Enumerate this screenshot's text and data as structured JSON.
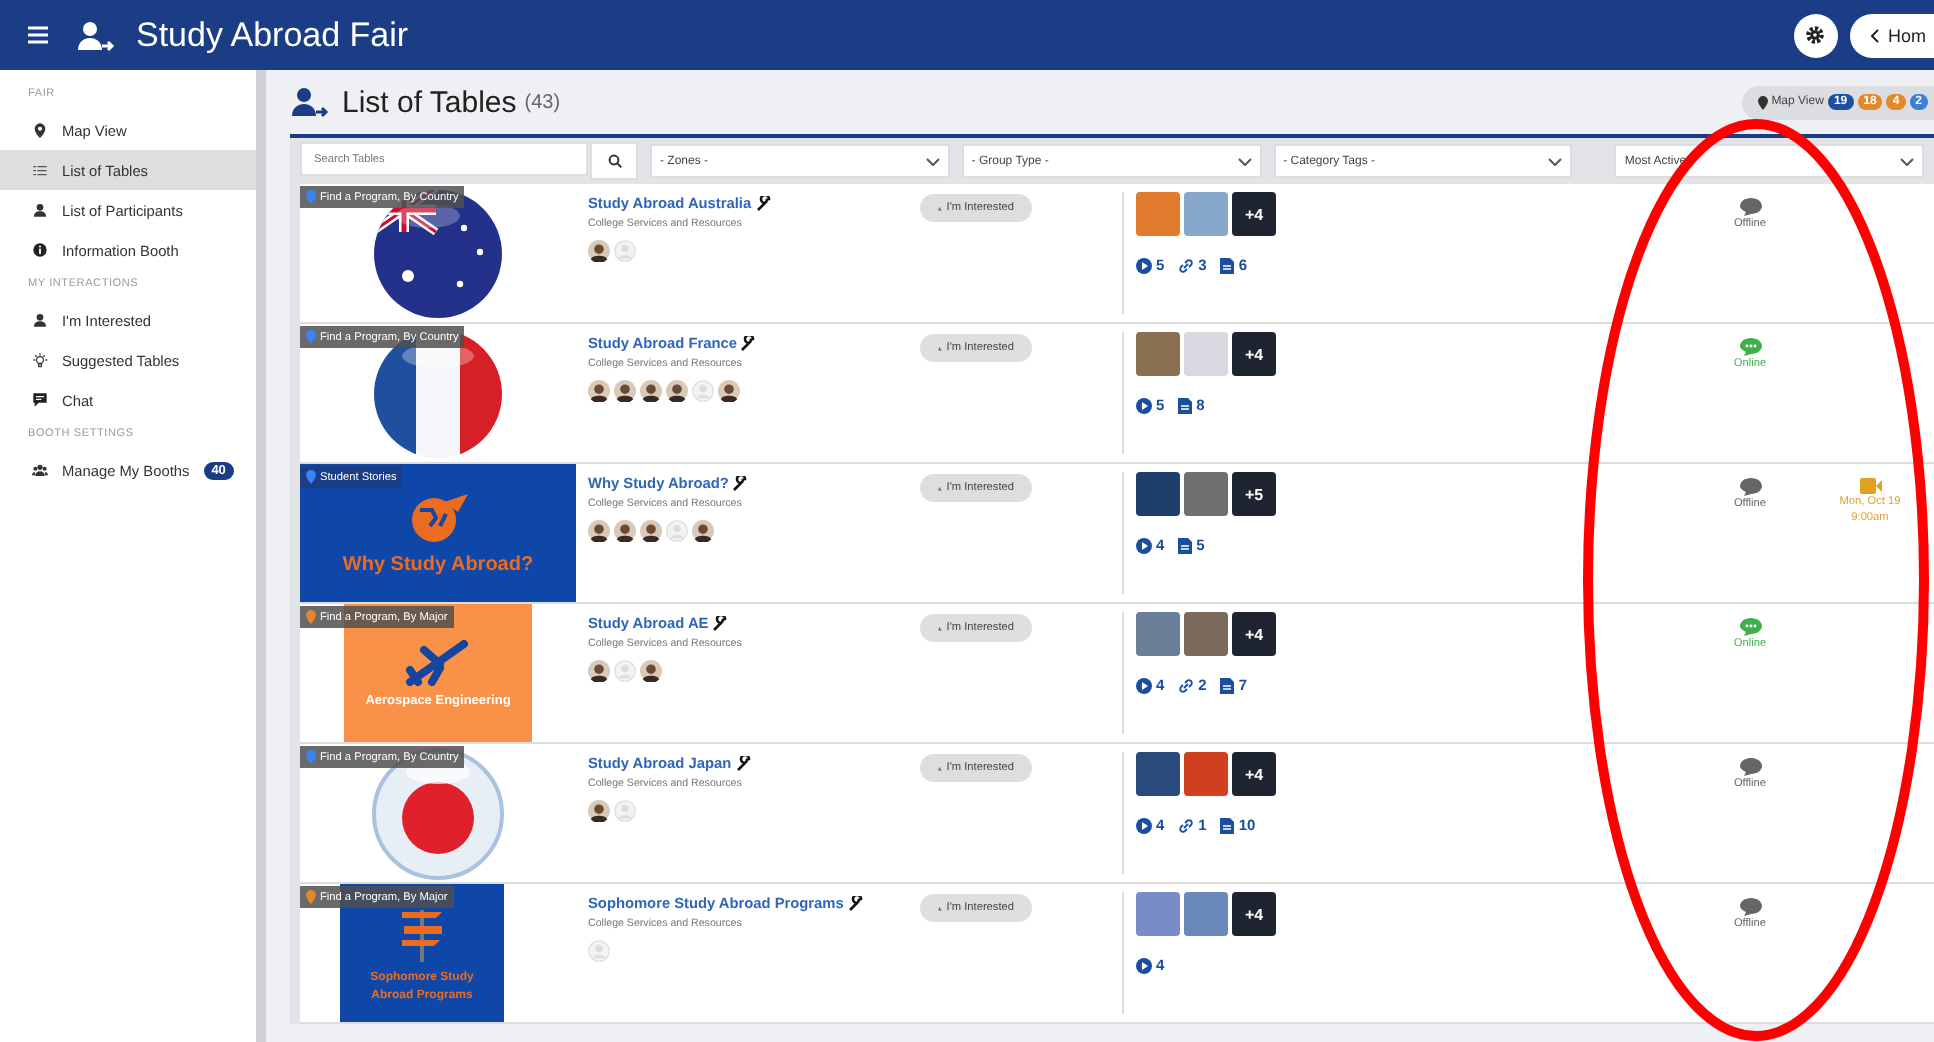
{
  "header": {
    "title": "Study Abroad Fair",
    "home_button": "Hom"
  },
  "sidebar": {
    "sections": [
      {
        "heading": "FAIR",
        "items": [
          {
            "label": "Map View",
            "selected": false
          },
          {
            "label": "List of Tables",
            "selected": true
          },
          {
            "label": "List of Participants",
            "selected": false
          },
          {
            "label": "Information Booth",
            "selected": false
          }
        ]
      },
      {
        "heading": "MY INTERACTIONS",
        "items": [
          {
            "label": "I'm Interested",
            "selected": false
          },
          {
            "label": "Suggested Tables",
            "selected": false
          },
          {
            "label": "Chat",
            "selected": false
          }
        ]
      },
      {
        "heading": "BOOTH SETTINGS",
        "items": [
          {
            "label": "Manage My Booths",
            "selected": false,
            "badge": "40"
          }
        ]
      }
    ]
  },
  "page": {
    "title": "List of Tables",
    "count": "(43)",
    "map_view": {
      "label": "Map View",
      "badges": [
        {
          "text": "19",
          "color": "#1e4ea1"
        },
        {
          "text": "18",
          "color": "#e08a2c"
        },
        {
          "text": "4",
          "color": "#e08a2c"
        },
        {
          "text": "2",
          "color": "#3b82d6"
        }
      ]
    }
  },
  "filters": {
    "search_placeholder": "Search Tables",
    "selects": [
      "- Zones -",
      "- Group Type -",
      "- Category Tags -",
      "Most Active"
    ]
  },
  "rows": [
    {
      "tag": {
        "text": "Find a Program, By Country",
        "kind": "country"
      },
      "image": {
        "kind": "flag-au"
      },
      "name": "Study Abroad Australia",
      "subtitle": "College Services and Resources",
      "avatars": [
        {
          "kind": "photo"
        },
        {
          "kind": "blank"
        }
      ],
      "button": "I'm Interested",
      "more": "+4",
      "stats": [
        {
          "kind": "video",
          "count": "5"
        },
        {
          "kind": "link",
          "count": "3"
        },
        {
          "kind": "doc",
          "count": "6"
        }
      ],
      "status": {
        "online": false,
        "label": "Offline"
      }
    },
    {
      "tag": {
        "text": "Find a Program, By Country",
        "kind": "country"
      },
      "image": {
        "kind": "flag-fr"
      },
      "name": "Study Abroad France",
      "subtitle": "College Services and Resources",
      "avatars": [
        {
          "kind": "photo"
        },
        {
          "kind": "photo"
        },
        {
          "kind": "photo"
        },
        {
          "kind": "photo"
        },
        {
          "kind": "blank"
        },
        {
          "kind": "photo"
        }
      ],
      "button": "I'm Interested",
      "more": "+4",
      "stats": [
        {
          "kind": "video",
          "count": "5"
        },
        {
          "kind": "doc",
          "count": "8"
        }
      ],
      "status": {
        "online": true,
        "label": "Online"
      }
    },
    {
      "tag": {
        "text": "Student Stories",
        "kind": "stories"
      },
      "image": {
        "kind": "globe-banner",
        "text": "Why Study Abroad?"
      },
      "name": "Why Study Abroad?",
      "subtitle": "College Services and Resources",
      "avatars": [
        {
          "kind": "photo"
        },
        {
          "kind": "photo"
        },
        {
          "kind": "photo"
        },
        {
          "kind": "blank"
        },
        {
          "kind": "photo"
        }
      ],
      "button": "I'm Interested",
      "more": "+5",
      "stats": [
        {
          "kind": "video",
          "count": "4"
        },
        {
          "kind": "doc",
          "count": "5"
        }
      ],
      "status": {
        "online": false,
        "label": "Offline"
      },
      "event": {
        "date": "Mon, Oct 19",
        "time": "9:00am"
      }
    },
    {
      "tag": {
        "text": "Find a Program, By Major",
        "kind": "major"
      },
      "image": {
        "kind": "plane-banner",
        "text": "Aerospace Engineering"
      },
      "name": "Study Abroad AE",
      "subtitle": "College Services and Resources",
      "avatars": [
        {
          "kind": "photo"
        },
        {
          "kind": "blank"
        },
        {
          "kind": "photo"
        }
      ],
      "button": "I'm Interested",
      "more": "+4",
      "stats": [
        {
          "kind": "video",
          "count": "4"
        },
        {
          "kind": "link",
          "count": "2"
        },
        {
          "kind": "doc",
          "count": "7"
        }
      ],
      "status": {
        "online": true,
        "label": "Online"
      }
    },
    {
      "tag": {
        "text": "Find a Program, By Country",
        "kind": "country"
      },
      "image": {
        "kind": "flag-jp"
      },
      "name": "Study Abroad Japan",
      "subtitle": "College Services and Resources",
      "avatars": [
        {
          "kind": "photo"
        },
        {
          "kind": "blank"
        }
      ],
      "button": "I'm Interested",
      "more": "+4",
      "stats": [
        {
          "kind": "video",
          "count": "4"
        },
        {
          "kind": "link",
          "count": "1"
        },
        {
          "kind": "doc",
          "count": "10"
        }
      ],
      "status": {
        "online": false,
        "label": "Offline"
      }
    },
    {
      "tag": {
        "text": "Find a Program, By Major",
        "kind": "major"
      },
      "image": {
        "kind": "sign-banner",
        "text": "Sophomore Study Abroad Programs"
      },
      "name": "Sophomore Study Abroad Programs",
      "subtitle": "College Services and Resources",
      "avatars": [
        {
          "kind": "blank"
        }
      ],
      "button": "I'm Interested",
      "more": "+4",
      "stats": [
        {
          "kind": "video",
          "count": "4"
        }
      ],
      "status": {
        "online": false,
        "label": "Offline"
      }
    }
  ]
}
